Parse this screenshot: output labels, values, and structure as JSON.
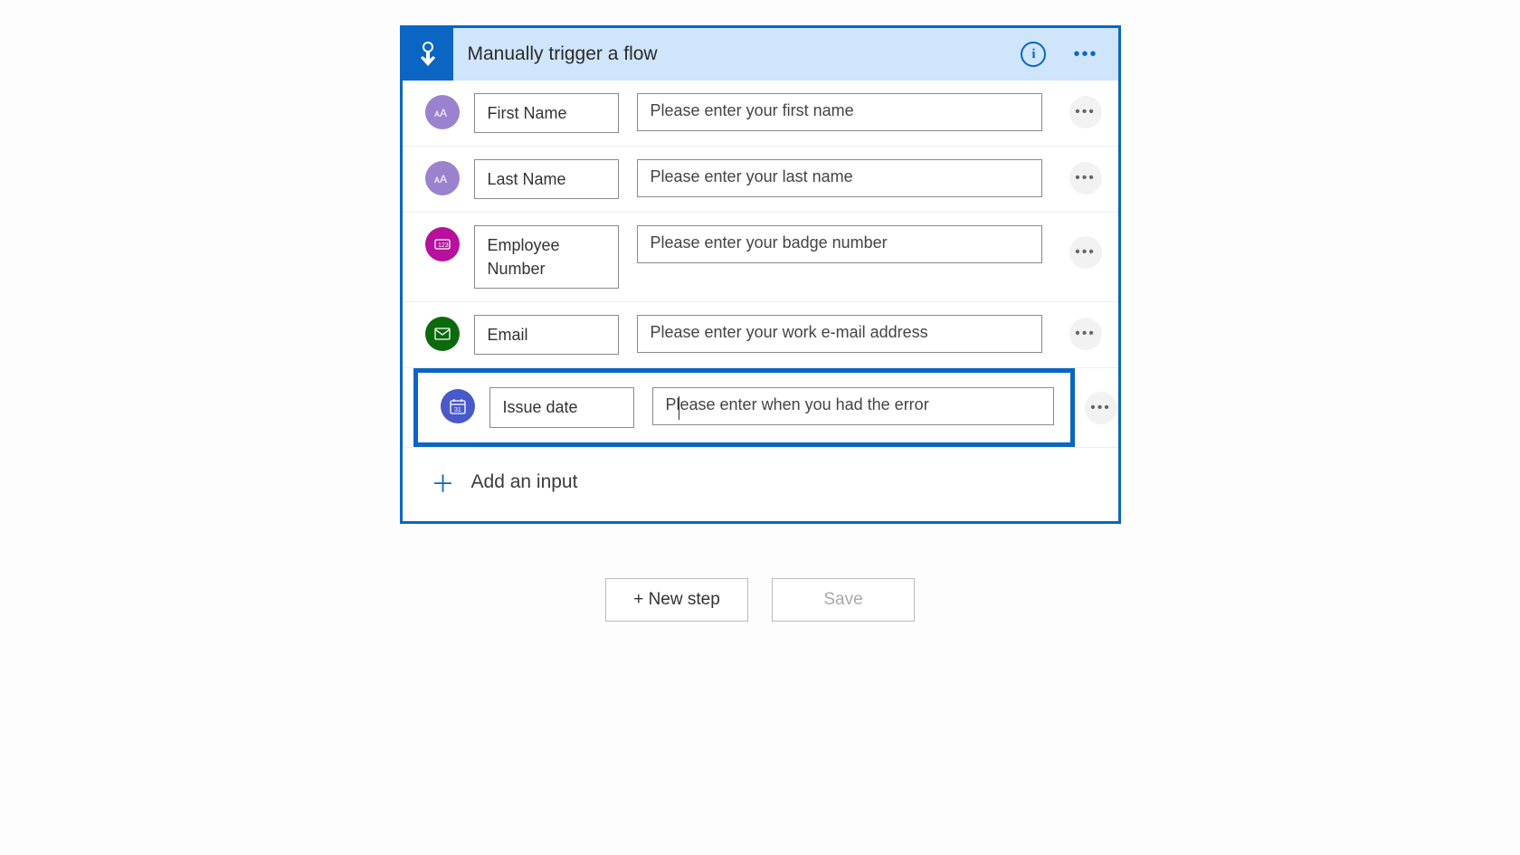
{
  "trigger": {
    "title": "Manually trigger a flow"
  },
  "inputs": [
    {
      "type": "text",
      "label": "First Name",
      "placeholder": "Please enter your first name"
    },
    {
      "type": "text",
      "label": "Last Name",
      "placeholder": "Please enter your last name"
    },
    {
      "type": "number",
      "label": "Employee Number",
      "placeholder": "Please enter your badge number"
    },
    {
      "type": "email",
      "label": "Email",
      "placeholder": "Please enter your work e-mail address"
    },
    {
      "type": "date",
      "label": "Issue date",
      "placeholder": "Please enter when you had the error",
      "selected": true
    }
  ],
  "actions": {
    "add_input": "Add an input",
    "new_step": "+ New step",
    "save": "Save"
  }
}
